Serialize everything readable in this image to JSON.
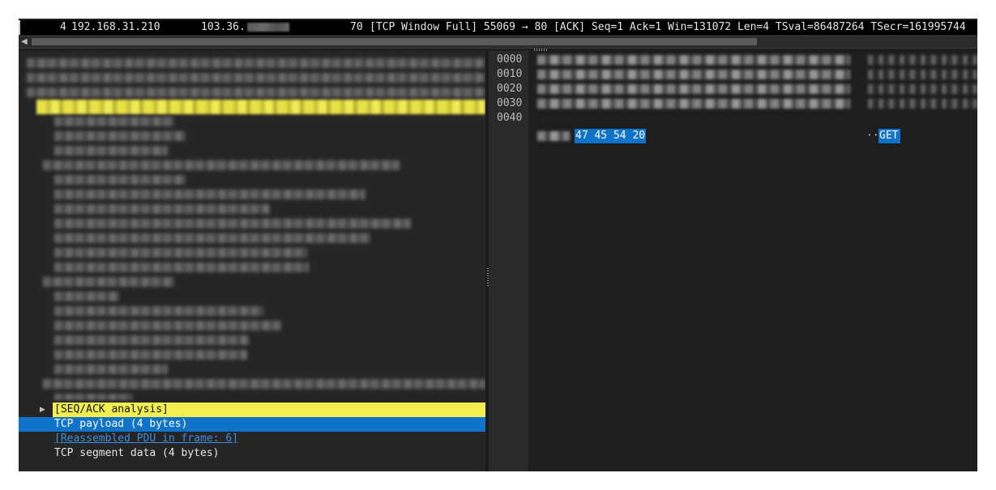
{
  "packet_list": {
    "row": {
      "number": "4",
      "source": "192.168.31.210",
      "destination_prefix": "103.36.",
      "length": "70",
      "info": "[TCP Window Full] 55069 → 80 [ACK] Seq=1 Ack=1 Win=131072 Len=4 TSval=86487264 TSecr=161995744"
    }
  },
  "tree": {
    "rows": [
      {
        "label": "[SEQ/ACK analysis]",
        "expander": "▶"
      },
      {
        "label": "TCP payload (4 bytes)"
      },
      {
        "label": "[Reassembled PDU in frame: 6]"
      },
      {
        "label": "TCP segment data (4 bytes)"
      }
    ]
  },
  "bytes": {
    "offsets": [
      "0000",
      "0010",
      "0020",
      "0030",
      "0040"
    ],
    "selected_hex": "47 45 54 20",
    "ascii_prefix": "··",
    "selected_ascii": "GET"
  },
  "colors": {
    "highlight_yellow": "#f3ee4f",
    "selection_blue": "#0e73c9",
    "link_blue": "#3c8fe0",
    "background": "#1e1e1e"
  }
}
